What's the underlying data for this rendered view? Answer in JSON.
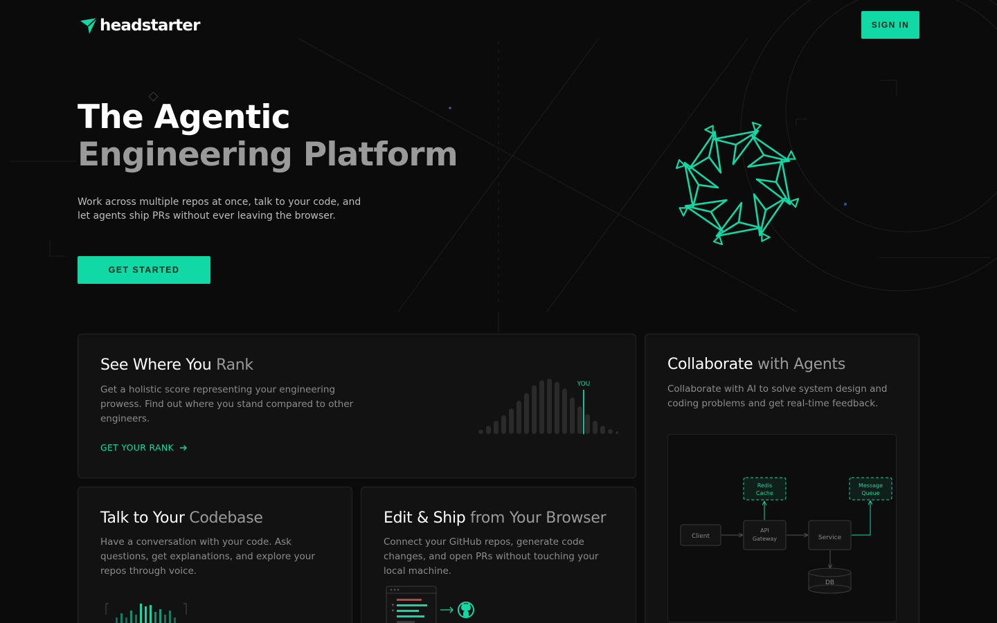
{
  "header": {
    "logo_text": "headstarter",
    "signin_label": "SIGN IN"
  },
  "hero": {
    "title_line1": "The Agentic",
    "title_line2": "Engineering Platform",
    "subtitle": "Work across multiple repos at once, talk to your code, and let agents ship PRs without ever leaving the browser.",
    "cta_label": "GET STARTED"
  },
  "cards": {
    "rank": {
      "title_a": "See Where You ",
      "title_b": "Rank",
      "description": "Get a holistic score representing your engineering prowess. Find out where you stand compared to other engineers.",
      "link_label": "GET YOUR RANK",
      "marker_label": "YOU",
      "distribution": [
        0.08,
        0.15,
        0.24,
        0.34,
        0.46,
        0.6,
        0.74,
        0.88,
        0.97,
        1.0,
        0.94,
        0.82,
        0.66,
        0.5,
        0.36,
        0.24,
        0.15,
        0.09,
        0.05
      ],
      "you_index": 13
    },
    "collab": {
      "title_a": "Collaborate ",
      "title_b": "with Agents",
      "description": "Collaborate with AI to solve system design and coding problems and get real-time feedback.",
      "diagram": {
        "client": "Client",
        "gateway_1": "API",
        "gateway_2": "Gateway",
        "service": "Service",
        "db": "DB",
        "redis_1": "Redis",
        "redis_2": "Cache",
        "queue_1": "Message",
        "queue_2": "Queue"
      }
    },
    "talk": {
      "title_a": "Talk to Your ",
      "title_b": "Codebase",
      "description": "Have a conversation with your code. Ask questions, get explanations, and explore your repos through voice."
    },
    "ship": {
      "title_a": "Edit & Ship ",
      "title_b": "from Your Browser",
      "description": "Connect your GitHub repos, generate code changes, and open PRs without touching your local machine."
    }
  },
  "colors": {
    "accent": "#10d9a6",
    "background": "#0b0b0b",
    "card": "#121212"
  }
}
